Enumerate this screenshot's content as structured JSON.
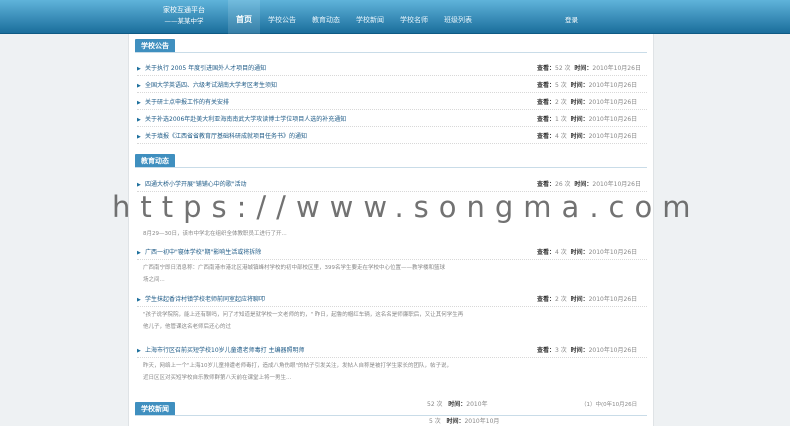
{
  "header": {
    "logo_line1": "家校互通平台",
    "logo_line2": "——某某中学",
    "nav": [
      "首页",
      "学校公告",
      "教育动态",
      "学校新闻",
      "学校名师",
      "班级列表"
    ],
    "login": "登录"
  },
  "announcements": {
    "heading": "学校公告",
    "view_label": "查看：",
    "time_label": "时间：",
    "items": [
      {
        "title": "关于执行 2005 年度引进国外人才项目的通知",
        "views": "52 次",
        "time": "2010年10月26日"
      },
      {
        "title": "全国大学英语四、六级考试湖南大学考区考生须知",
        "views": "5 次",
        "time": "2010年10月26日"
      },
      {
        "title": "关于研士点申报工作的有关安排",
        "views": "2 次",
        "time": "2010年10月26日"
      },
      {
        "title": "关于补选2006年赴美大利亚海南南武大学攻读博士学位项目人选的补充通知",
        "views": "1 次",
        "time": "2010年10月26日"
      },
      {
        "title": "关于填报《江西省省教育厅基础科研成就项目任务书》的通知",
        "views": "4 次",
        "time": "2010年10月26日"
      }
    ]
  },
  "news_dynamics": {
    "heading": "教育动态",
    "items": [
      {
        "title": "四通大桥小学开展\"铺铺心中的歌\"活动",
        "views": "26 次",
        "time": "2010年10月26日",
        "excerpt": []
      },
      {
        "title": "",
        "views": "",
        "time": "",
        "excerpt": [
          "8月29—30日，该市中学北在组织全体教职员工进行了开..."
        ]
      },
      {
        "title": "广西一初中\"寝体学校\"期\"影响生活或将拆除",
        "views": "4 次",
        "time": "2010年10月26日",
        "excerpt": [
          "广西南宁即日消息称：广西南港市港北区港城镇峰村学校的初中部校区里，399名学生要走在学校中心位置——教学楼和篮球",
          "场之间..."
        ]
      },
      {
        "title": "学生抹起香诗村镇学校老师前同室起应将聊叩",
        "views": "2 次",
        "time": "2010年10月26日",
        "excerpt": [
          "\"孩子说学院院，能上还有聊吗，问了才知道是就学校一文老师的的，\" 昨日，起鲁的帽红车辆，这名名是师廉职后，又让其何学生再",
          "他儿子，他管课这名老师后还心的过"
        ]
      },
      {
        "title": "上海市行区召前买短学校10岁儿童遭老师毒打 主编器照明师",
        "views": "3 次",
        "time": "2010年10月26日",
        "excerpt": [
          "昨天，网络上一个\"上海10岁儿童排遭老师毒打，造成八角伤眼\"的帖子引发关注，发帖人自称是被打学生家长的团队，帖子说，",
          "近日区区对买短学校自乐教师群第八天前在课堂上将一男生..."
        ]
      }
    ]
  },
  "school_news": {
    "heading": "学校新闻",
    "items": [
      {
        "views": "52 次",
        "time_label": "时间：",
        "time": "2010年"
      },
      {
        "views": "5 次",
        "time_label": "时间：",
        "time": "2010年10月"
      }
    ],
    "side_note": "（1）中(0年10月26日"
  },
  "watermark": "https://www.songma.com"
}
